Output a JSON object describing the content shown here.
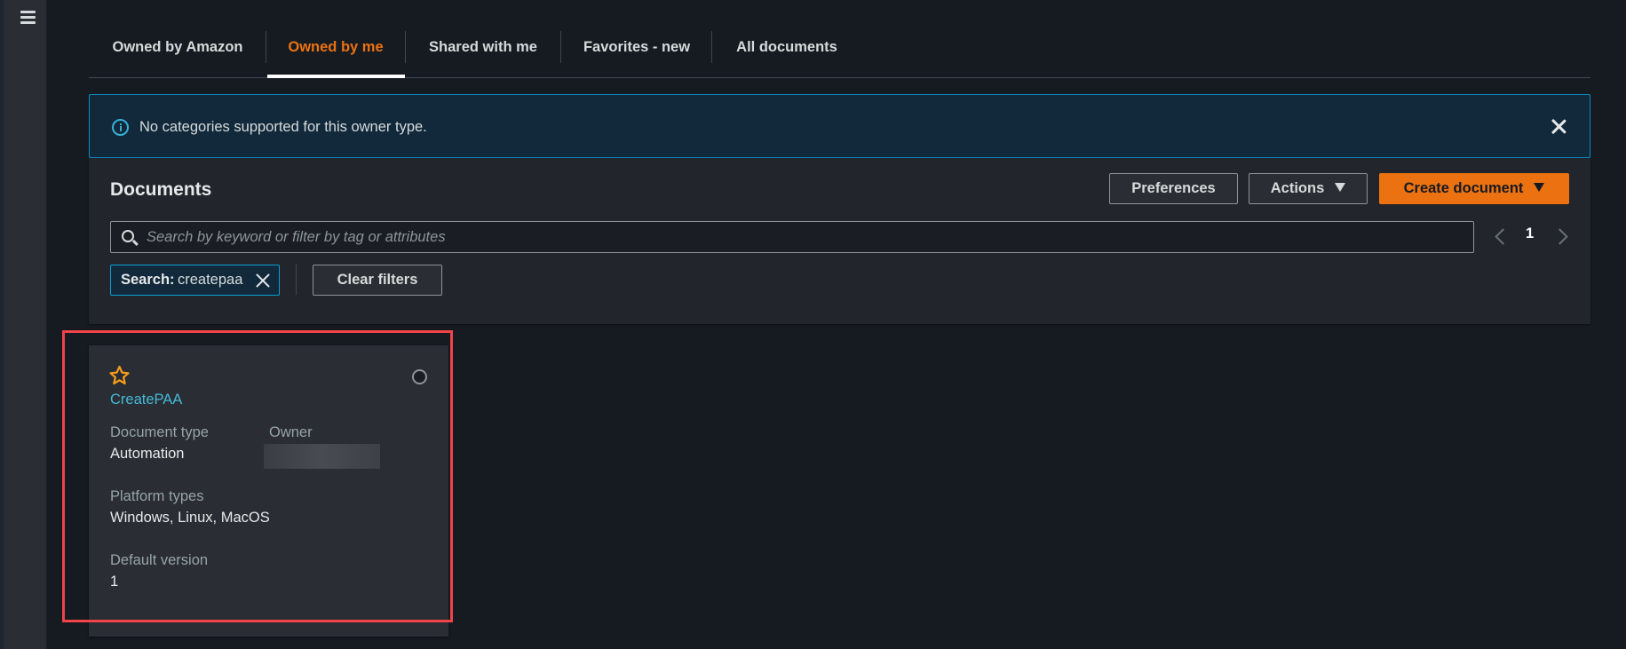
{
  "nav": {
    "menu_icon": "hamburger-menu-icon"
  },
  "tabs": [
    {
      "label": "Owned by Amazon",
      "active": false
    },
    {
      "label": "Owned by me",
      "active": true
    },
    {
      "label": "Shared with me",
      "active": false
    },
    {
      "label": "Favorites - new",
      "active": false
    },
    {
      "label": "All documents",
      "active": false
    }
  ],
  "banner": {
    "icon": "info-icon",
    "message": "No categories supported for this owner type.",
    "close_icon": "close-icon"
  },
  "documents_panel": {
    "title": "Documents",
    "preferences_label": "Preferences",
    "actions_label": "Actions",
    "create_label": "Create document",
    "search": {
      "placeholder": "Search by keyword or filter by tag or attributes",
      "value": ""
    },
    "pagination": {
      "current_page": "1"
    },
    "filter_token": {
      "label": "Search:",
      "value": "createpaa"
    },
    "clear_filters_label": "Clear filters"
  },
  "cards": [
    {
      "name": "CreatePAA",
      "favorite": false,
      "selected": false,
      "fields": {
        "document_type_label": "Document type",
        "document_type": "Automation",
        "owner_label": "Owner",
        "owner": "[redacted]",
        "platform_types_label": "Platform types",
        "platform_types": "Windows, Linux, MacOS",
        "default_version_label": "Default version",
        "default_version": "1"
      }
    }
  ],
  "colors": {
    "accent_orange": "#ec7211",
    "link_blue": "#44b9d6",
    "info_border": "#0a8cbf",
    "highlight_red": "#f0444a"
  }
}
